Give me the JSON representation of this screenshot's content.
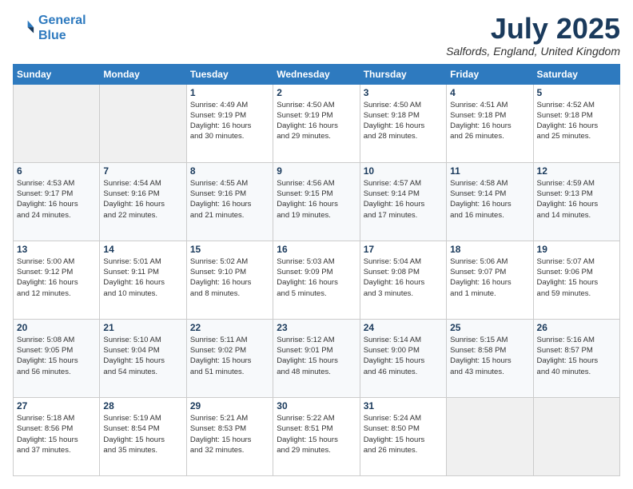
{
  "logo": {
    "line1": "General",
    "line2": "Blue"
  },
  "title": "July 2025",
  "location": "Salfords, England, United Kingdom",
  "headers": [
    "Sunday",
    "Monday",
    "Tuesday",
    "Wednesday",
    "Thursday",
    "Friday",
    "Saturday"
  ],
  "weeks": [
    [
      {
        "day": "",
        "detail": ""
      },
      {
        "day": "",
        "detail": ""
      },
      {
        "day": "1",
        "detail": "Sunrise: 4:49 AM\nSunset: 9:19 PM\nDaylight: 16 hours\nand 30 minutes."
      },
      {
        "day": "2",
        "detail": "Sunrise: 4:50 AM\nSunset: 9:19 PM\nDaylight: 16 hours\nand 29 minutes."
      },
      {
        "day": "3",
        "detail": "Sunrise: 4:50 AM\nSunset: 9:18 PM\nDaylight: 16 hours\nand 28 minutes."
      },
      {
        "day": "4",
        "detail": "Sunrise: 4:51 AM\nSunset: 9:18 PM\nDaylight: 16 hours\nand 26 minutes."
      },
      {
        "day": "5",
        "detail": "Sunrise: 4:52 AM\nSunset: 9:18 PM\nDaylight: 16 hours\nand 25 minutes."
      }
    ],
    [
      {
        "day": "6",
        "detail": "Sunrise: 4:53 AM\nSunset: 9:17 PM\nDaylight: 16 hours\nand 24 minutes."
      },
      {
        "day": "7",
        "detail": "Sunrise: 4:54 AM\nSunset: 9:16 PM\nDaylight: 16 hours\nand 22 minutes."
      },
      {
        "day": "8",
        "detail": "Sunrise: 4:55 AM\nSunset: 9:16 PM\nDaylight: 16 hours\nand 21 minutes."
      },
      {
        "day": "9",
        "detail": "Sunrise: 4:56 AM\nSunset: 9:15 PM\nDaylight: 16 hours\nand 19 minutes."
      },
      {
        "day": "10",
        "detail": "Sunrise: 4:57 AM\nSunset: 9:14 PM\nDaylight: 16 hours\nand 17 minutes."
      },
      {
        "day": "11",
        "detail": "Sunrise: 4:58 AM\nSunset: 9:14 PM\nDaylight: 16 hours\nand 16 minutes."
      },
      {
        "day": "12",
        "detail": "Sunrise: 4:59 AM\nSunset: 9:13 PM\nDaylight: 16 hours\nand 14 minutes."
      }
    ],
    [
      {
        "day": "13",
        "detail": "Sunrise: 5:00 AM\nSunset: 9:12 PM\nDaylight: 16 hours\nand 12 minutes."
      },
      {
        "day": "14",
        "detail": "Sunrise: 5:01 AM\nSunset: 9:11 PM\nDaylight: 16 hours\nand 10 minutes."
      },
      {
        "day": "15",
        "detail": "Sunrise: 5:02 AM\nSunset: 9:10 PM\nDaylight: 16 hours\nand 8 minutes."
      },
      {
        "day": "16",
        "detail": "Sunrise: 5:03 AM\nSunset: 9:09 PM\nDaylight: 16 hours\nand 5 minutes."
      },
      {
        "day": "17",
        "detail": "Sunrise: 5:04 AM\nSunset: 9:08 PM\nDaylight: 16 hours\nand 3 minutes."
      },
      {
        "day": "18",
        "detail": "Sunrise: 5:06 AM\nSunset: 9:07 PM\nDaylight: 16 hours\nand 1 minute."
      },
      {
        "day": "19",
        "detail": "Sunrise: 5:07 AM\nSunset: 9:06 PM\nDaylight: 15 hours\nand 59 minutes."
      }
    ],
    [
      {
        "day": "20",
        "detail": "Sunrise: 5:08 AM\nSunset: 9:05 PM\nDaylight: 15 hours\nand 56 minutes."
      },
      {
        "day": "21",
        "detail": "Sunrise: 5:10 AM\nSunset: 9:04 PM\nDaylight: 15 hours\nand 54 minutes."
      },
      {
        "day": "22",
        "detail": "Sunrise: 5:11 AM\nSunset: 9:02 PM\nDaylight: 15 hours\nand 51 minutes."
      },
      {
        "day": "23",
        "detail": "Sunrise: 5:12 AM\nSunset: 9:01 PM\nDaylight: 15 hours\nand 48 minutes."
      },
      {
        "day": "24",
        "detail": "Sunrise: 5:14 AM\nSunset: 9:00 PM\nDaylight: 15 hours\nand 46 minutes."
      },
      {
        "day": "25",
        "detail": "Sunrise: 5:15 AM\nSunset: 8:58 PM\nDaylight: 15 hours\nand 43 minutes."
      },
      {
        "day": "26",
        "detail": "Sunrise: 5:16 AM\nSunset: 8:57 PM\nDaylight: 15 hours\nand 40 minutes."
      }
    ],
    [
      {
        "day": "27",
        "detail": "Sunrise: 5:18 AM\nSunset: 8:56 PM\nDaylight: 15 hours\nand 37 minutes."
      },
      {
        "day": "28",
        "detail": "Sunrise: 5:19 AM\nSunset: 8:54 PM\nDaylight: 15 hours\nand 35 minutes."
      },
      {
        "day": "29",
        "detail": "Sunrise: 5:21 AM\nSunset: 8:53 PM\nDaylight: 15 hours\nand 32 minutes."
      },
      {
        "day": "30",
        "detail": "Sunrise: 5:22 AM\nSunset: 8:51 PM\nDaylight: 15 hours\nand 29 minutes."
      },
      {
        "day": "31",
        "detail": "Sunrise: 5:24 AM\nSunset: 8:50 PM\nDaylight: 15 hours\nand 26 minutes."
      },
      {
        "day": "",
        "detail": ""
      },
      {
        "day": "",
        "detail": ""
      }
    ]
  ]
}
